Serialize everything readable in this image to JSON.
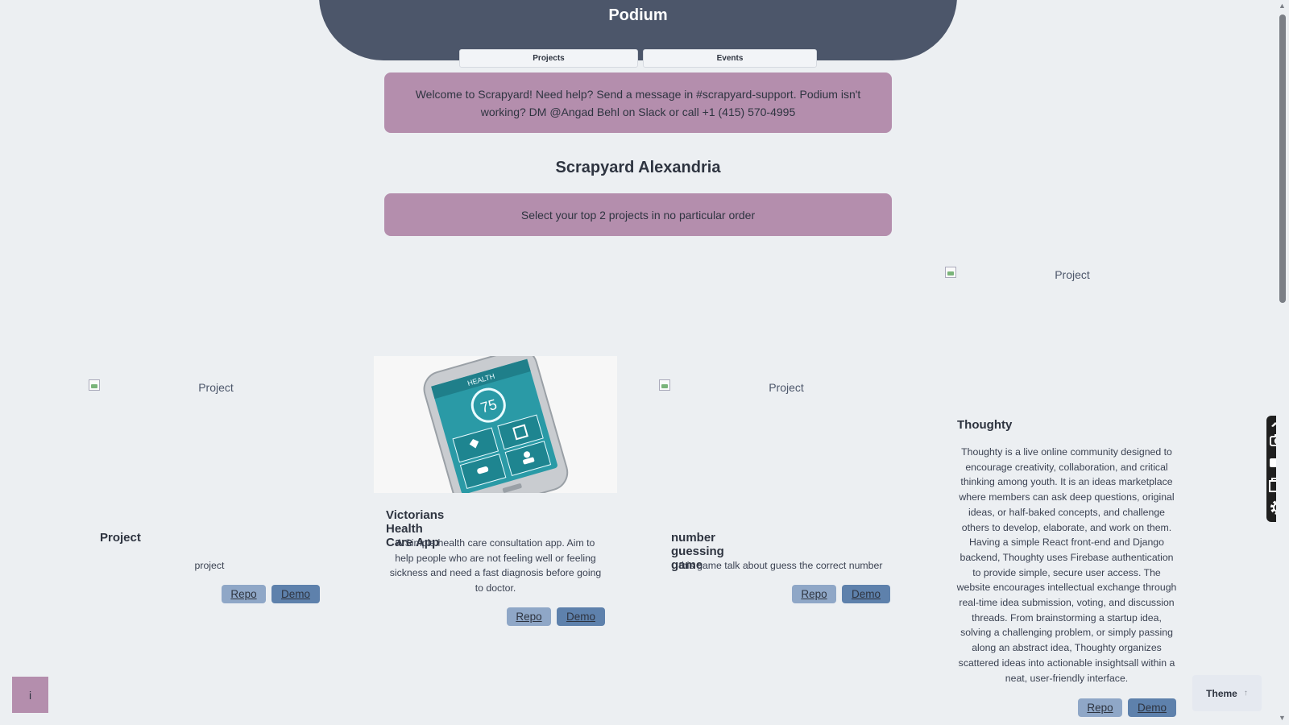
{
  "header": {
    "title": "Podium",
    "nav": [
      {
        "label": "Projects"
      },
      {
        "label": "Events"
      }
    ]
  },
  "banner": {
    "text": "Welcome to Scrapyard! Need help? Send a message in #scrapyard-support. Podium isn't working? DM @Angad Behl on Slack or call +1 (415) 570-4995"
  },
  "event": {
    "title": "Scrapyard Alexandria",
    "instruction": "Select your top 2 projects in no particular order"
  },
  "projects": [
    {
      "image_alt": "Project",
      "name": "Project",
      "description": "project",
      "repo_label": "Repo",
      "demo_label": "Demo"
    },
    {
      "image_alt": "",
      "name": "Victorians Health Care App",
      "description": "A Simple health care consultation app. Aim to help people who are not feeling well or feeling sickness and need a fast diagnosis before going to doctor.",
      "repo_label": "Repo",
      "demo_label": "Demo",
      "image_screen_text": "HEALTH",
      "image_screen_value": "75"
    },
    {
      "image_alt": "Project",
      "name": "number guessing game",
      "description": "this game talk about guess the correct number",
      "repo_label": "Repo",
      "demo_label": "Demo"
    },
    {
      "image_alt": "Project",
      "name": "Thoughty",
      "description": "Thoughty is a live online community designed to encourage creativity, collaboration, and critical thinking among youth. It is an ideas marketplace where members can ask deep questions, original ideas, or half-baked concepts, and challenge others to develop, elaborate, and work on them. Having a simple React front-end and Django backend, Thoughty uses Firebase authentication to provide simple, secure user access. The website encourages intellectual exchange through real-time idea submission, voting, and discussion threads. From brainstorming a startup idea, solving a challenging problem, or simply passing along an abstract idea, Thoughty organizes scattered ideas into actionable insightsall within a neat, user-friendly interface.",
      "repo_label": "Repo",
      "demo_label": "Demo"
    }
  ],
  "footer": {
    "info_label": "i",
    "theme_label": "Theme",
    "theme_arrow": "↑"
  },
  "icons": {
    "side_tools": [
      "pen-icon",
      "camera-icon",
      "video-icon",
      "window-icon",
      "gear-icon"
    ]
  },
  "colors": {
    "header_bg": "#4c566a",
    "banner_bg": "#b48ead",
    "repo_bg": "#8fa7c7",
    "demo_bg": "#5e81ac",
    "page_bg": "#eceff2"
  }
}
